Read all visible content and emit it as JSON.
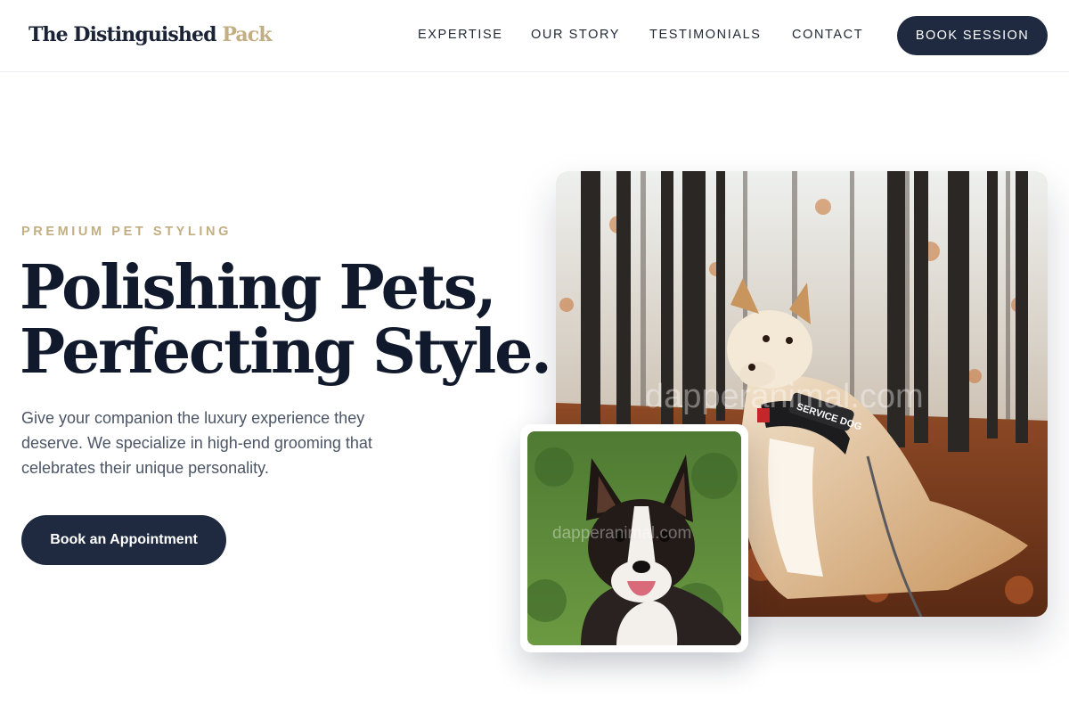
{
  "brand": {
    "name_main": "The Distinguished",
    "name_accent": "Pack"
  },
  "nav": {
    "items": [
      {
        "label": "EXPERTISE"
      },
      {
        "label": "OUR STORY"
      },
      {
        "label": "TESTIMONIALS"
      },
      {
        "label": "CONTACT"
      }
    ],
    "cta_label": "BOOK SESSION"
  },
  "hero": {
    "eyebrow": "PREMIUM PET STYLING",
    "headline_line1": "Polishing Pets,",
    "headline_line2": "Perfecting Style.",
    "subtext": "Give your companion the luxury experience they deserve. We specialize in high-end grooming that celebrates their unique personality.",
    "cta_label": "Book an Appointment"
  },
  "images": {
    "main": {
      "subject": "dog-in-autumn-forest",
      "harness_text": "SERVICE DOG",
      "watermark": "dapperanimal.com"
    },
    "small": {
      "subject": "border-collie-portrait",
      "watermark": "dapperanimal.com"
    }
  },
  "colors": {
    "navy": "#1f2a40",
    "gold": "#c2ae82",
    "text_dark": "#111a2c",
    "text_muted": "#4b5566"
  }
}
